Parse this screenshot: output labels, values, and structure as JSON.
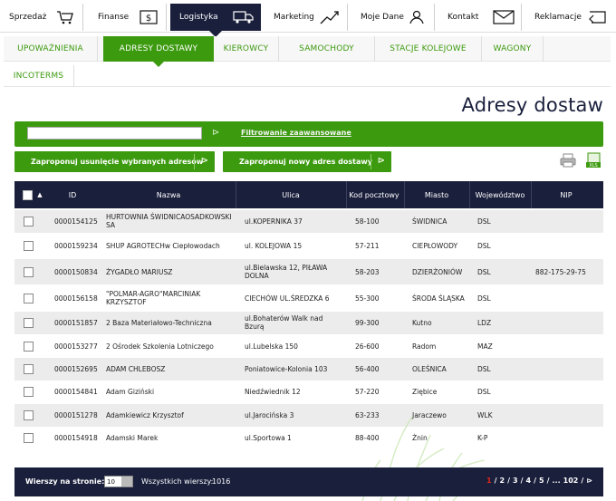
{
  "topnav": {
    "items": [
      {
        "label": "Sprzedaż",
        "icon": "cart-icon"
      },
      {
        "label": "Finanse",
        "icon": "money-icon"
      },
      {
        "label": "Logistyka",
        "icon": "truck-icon",
        "active": true
      },
      {
        "label": "Marketing",
        "icon": "chart-up-icon"
      },
      {
        "label": "Moje Dane",
        "icon": "user-icon"
      },
      {
        "label": "Kontakt",
        "icon": "envelope-icon"
      },
      {
        "label": "Reklamacje",
        "icon": "return-icon"
      }
    ]
  },
  "subtabs": {
    "row1": [
      "UPOWAŻNIENIA",
      "ADRESY DOSTAWY",
      "KIEROWCY",
      "SAMOCHODY",
      "STACJE KOLEJOWE",
      "WAGONY"
    ],
    "row2": [
      "INCOTERMS"
    ],
    "active": "ADRESY DOSTAWY"
  },
  "page": {
    "title": "Adresy dostaw"
  },
  "filter": {
    "value": "",
    "advanced_link": "Filtrowanie zaawansowane"
  },
  "actions": {
    "remove": "Zaproponuj usunięcie wybranych adresów",
    "add": "Zaproponuj nowy adres dostawy"
  },
  "table": {
    "headers": {
      "id": "ID",
      "name": "Nazwa",
      "street": "Ulica",
      "zip": "Kod pocztowy",
      "city": "Miasto",
      "region": "Województwo",
      "nip": "NIP"
    },
    "rows": [
      {
        "id": "0000154125",
        "name": "HURTOWNIA ŚWIDNICAOSADKOWSKI SA",
        "street": "ul.KOPERNIKA 37",
        "zip": "58-100",
        "city": "ŚWIDNICA",
        "region": "DSL",
        "nip": ""
      },
      {
        "id": "0000159234",
        "name": "SHUP AGROTECHw Ciepłowodach",
        "street": "ul. KOLEJOWA 15",
        "zip": "57-211",
        "city": "CIEPŁOWODY",
        "region": "DSL",
        "nip": ""
      },
      {
        "id": "0000150834",
        "name": "ŻYGADŁO MARIUSZ",
        "street": "ul.Bielawska 12, PIŁAWA DOLNA",
        "zip": "58-203",
        "city": "DZIERŻONIÓW",
        "region": "DSL",
        "nip": "882-175-29-75"
      },
      {
        "id": "0000156158",
        "name": "\"POLMAR-AGRO\"MARCINIAK KRZYSZTOF",
        "street": "CIECHÓW UL.ŚREDZKA 6",
        "zip": "55-300",
        "city": "ŚRODA ŚLĄSKA",
        "region": "DSL",
        "nip": ""
      },
      {
        "id": "0000151857",
        "name": "2 Baza Materiałowo-Techniczna",
        "street": "ul.Bohaterów Walk nad Bzurą",
        "zip": "99-300",
        "city": "Kutno",
        "region": "LDZ",
        "nip": ""
      },
      {
        "id": "0000153277",
        "name": "2 Ośrodek Szkolenia Lotniczego",
        "street": "ul.Lubelska 150",
        "zip": "26-600",
        "city": "Radom",
        "region": "MAZ",
        "nip": ""
      },
      {
        "id": "0000152695",
        "name": "ADAM CHLEBOSZ",
        "street": "Poniatowice-Kolonia 103",
        "zip": "56-400",
        "city": "OLEŚNICA",
        "region": "DSL",
        "nip": ""
      },
      {
        "id": "0000154841",
        "name": "Adam Giziński",
        "street": "Niedźwiednik 12",
        "zip": "57-220",
        "city": "Ziębice",
        "region": "DSL",
        "nip": ""
      },
      {
        "id": "0000151278",
        "name": "Adamkiewicz Krzysztof",
        "street": "ul.Jarocińska 3",
        "zip": "63-233",
        "city": "Jaraczewo",
        "region": "WLK",
        "nip": ""
      },
      {
        "id": "0000154918",
        "name": "Adamski Marek",
        "street": "ul.Sportowa 1",
        "zip": "88-400",
        "city": "Żnin",
        "region": "K-P",
        "nip": ""
      }
    ]
  },
  "footer": {
    "rows_label": "Wierszy na stronie:",
    "rows_value": "10",
    "total_label": "Wszystkich wierszy:",
    "total_value": "1016",
    "pages": [
      "1",
      "/",
      "2",
      "/",
      "3",
      "/",
      "4",
      "/",
      "5",
      "/",
      "...",
      "102",
      "/"
    ],
    "current_page": "1"
  },
  "colors": {
    "navy": "#1a1f3c",
    "green": "#3c9a0f",
    "current_page": "#e2261a"
  }
}
